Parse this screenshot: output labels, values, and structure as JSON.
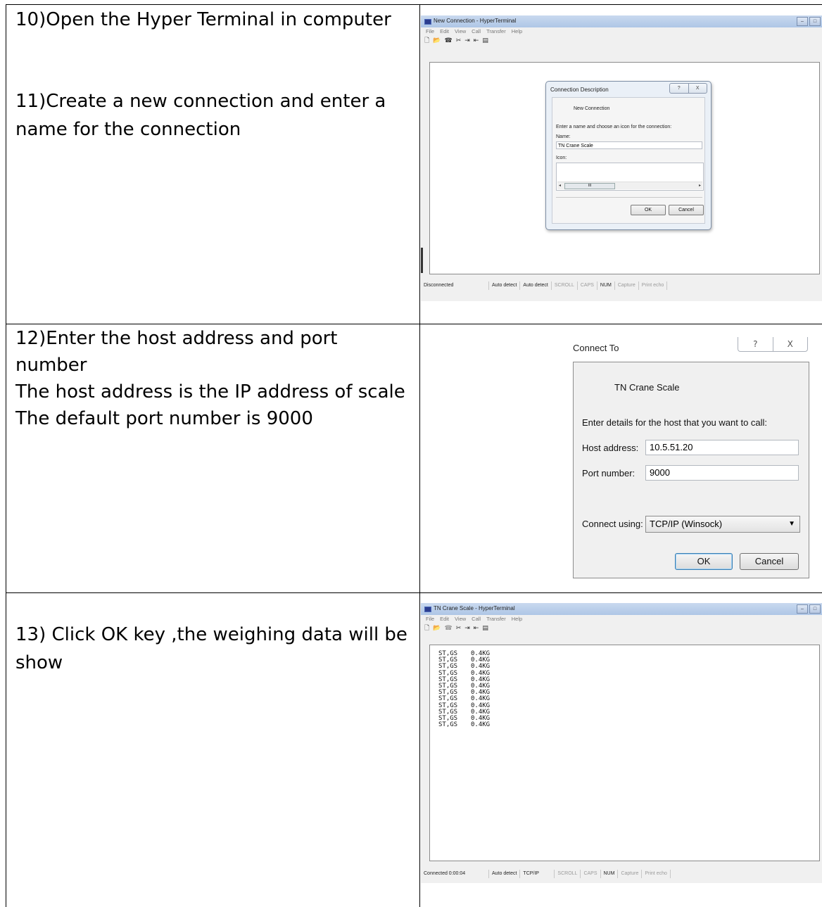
{
  "steps": [
    {
      "lines": [
        "10)Open the Hyper Terminal in computer"
      ]
    },
    {
      "lines": [
        "11)Create a new connection and enter a",
        "name for the connection"
      ]
    },
    {
      "lines": [
        "12)Enter the host address and port",
        "number",
        "The host address is the IP address of scale",
        "The default port number is 9000"
      ]
    },
    {
      "lines": [
        "13) Click OK key ,the weighing data will be",
        "show"
      ]
    }
  ],
  "window1": {
    "title": "New Connection - HyperTerminal",
    "menu": [
      "File",
      "Edit",
      "View",
      "Call",
      "Transfer",
      "Help"
    ],
    "status": [
      "Disconnected",
      "Auto detect",
      "Auto detect",
      "SCROLL",
      "CAPS",
      "NUM",
      "Capture",
      "Print echo"
    ],
    "dialog": {
      "title": "Connection Description",
      "help_btn": "?",
      "close_btn": "X",
      "heading": "New Connection",
      "prompt": "Enter a name and choose an icon for the connection:",
      "name_label": "Name:",
      "name_value": "TN Crane Scale",
      "icon_label": "Icon:",
      "scroll_thumb": "III",
      "ok": "OK",
      "cancel": "Cancel"
    }
  },
  "connect_to": {
    "title": "Connect To",
    "help_btn": "?",
    "close_btn": "X",
    "heading": "TN Crane Scale",
    "prompt": "Enter details for the host that you want to call:",
    "host_label": "Host address:",
    "host_value": "10.5.51.20",
    "port_label": "Port number:",
    "port_value": "9000",
    "using_label": "Connect using:",
    "using_value": "TCP/IP (Winsock)",
    "ok": "OK",
    "cancel": "Cancel"
  },
  "window2": {
    "title": "TN Crane Scale - HyperTerminal",
    "menu": [
      "File",
      "Edit",
      "View",
      "Call",
      "Transfer",
      "Help"
    ],
    "status": [
      "Connected 0:00:04",
      "Auto detect",
      "TCP/IP",
      "SCROLL",
      "CAPS",
      "NUM",
      "Capture",
      "Print echo"
    ],
    "output": [
      [
        "ST,GS",
        "0.4KG"
      ],
      [
        "ST,GS",
        "0.4KG"
      ],
      [
        "ST,GS",
        "0.4KG"
      ],
      [
        "ST,GS",
        "0.4KG"
      ],
      [
        "ST,GS",
        "0.4KG"
      ],
      [
        "ST,GS",
        "0.4KG"
      ],
      [
        "ST,GS",
        "0.4KG"
      ],
      [
        "ST,GS",
        "0.4KG"
      ],
      [
        "ST,GS",
        "0.4KG"
      ],
      [
        "ST,GS",
        "0.4KG"
      ],
      [
        "ST,GS",
        "0.4KG"
      ],
      [
        "ST,GS",
        "0.4KG"
      ]
    ]
  },
  "window_buttons": {
    "minimize": "–",
    "maximize": "□"
  },
  "toolbar_icons": [
    "new-icon",
    "open-icon",
    "phone-icon",
    "disconnect-icon",
    "send-icon",
    "receive-icon",
    "properties-icon"
  ]
}
